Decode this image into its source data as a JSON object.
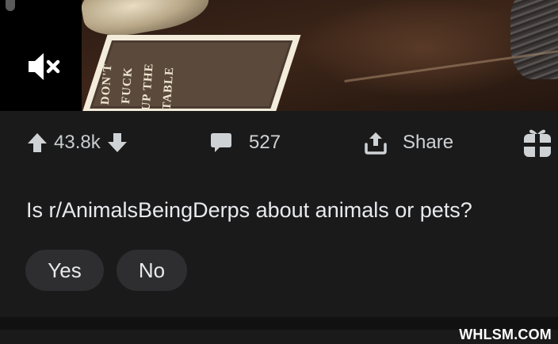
{
  "video": {
    "sign_lines": [
      "DON'T",
      "FUCK",
      "UP THE",
      "TABLE"
    ],
    "mute_icon": "volume-muted-icon",
    "muted": true
  },
  "actions": {
    "upvote_icon": "arrow-up-icon",
    "vote_count": "43.8k",
    "downvote_icon": "arrow-down-icon",
    "comment_icon": "comment-bubble-icon",
    "comment_count": "527",
    "share_icon": "share-upload-icon",
    "share_label": "Share",
    "award_icon": "gift-icon"
  },
  "poll": {
    "question": "Is r/AnimalsBeingDerps about animals or pets?",
    "options": [
      "Yes",
      "No"
    ]
  },
  "watermark": "WHLSM.COM",
  "colors": {
    "background": "#1a1a1b",
    "text": "#e8eaed",
    "icon": "#cfd2d4",
    "pill": "#2e2e30"
  }
}
